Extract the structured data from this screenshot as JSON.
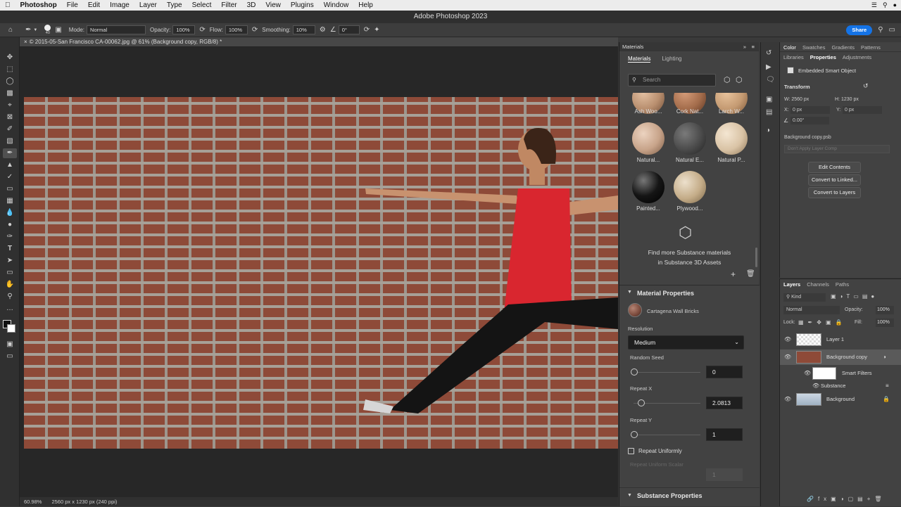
{
  "menubar": {
    "apple": "",
    "items": [
      "Photoshop",
      "File",
      "Edit",
      "Image",
      "Layer",
      "Type",
      "Select",
      "Filter",
      "3D",
      "View",
      "Plugins",
      "Window",
      "Help"
    ]
  },
  "title": "Adobe Photoshop 2023",
  "options": {
    "brush_size": "40",
    "mode_label": "Mode:",
    "mode_value": "Normal",
    "opacity_label": "Opacity:",
    "opacity_value": "100%",
    "flow_label": "Flow:",
    "flow_value": "100%",
    "smoothing_label": "Smoothing:",
    "smoothing_value": "10%",
    "angle_value": "0°",
    "share": "Share"
  },
  "doc_tab": "© 2015-05-San Francisco CA-00062.jpg @ 61% (Background copy, RGB/8) *",
  "status": {
    "zoom": "60.98%",
    "info": "2560 px x 1230 px (240 ppi)"
  },
  "materials": {
    "panel_title": "Materials",
    "tabs": [
      "Materials",
      "Lighting"
    ],
    "search_placeholder": "Search",
    "items": [
      {
        "label": "Ash Woo...",
        "color": "#b88e6e"
      },
      {
        "label": "Cork Nat...",
        "color": "#a36c4b"
      },
      {
        "label": "Larch W...",
        "color": "#c49a72"
      },
      {
        "label": "Natural...",
        "color": "#c7a389"
      },
      {
        "label": "Natural E...",
        "color": "#4a4a4a"
      },
      {
        "label": "Natural P...",
        "color": "#d9c3a5"
      },
      {
        "label": "Painted...",
        "color": "#151515"
      },
      {
        "label": "Plywood...",
        "color": "#c4ac88"
      }
    ],
    "find_more_line1": "Find more Substance materials",
    "find_more_line2": "in Substance 3D Assets"
  },
  "material_properties": {
    "title": "Material Properties",
    "material_name": "Cartagena Wall Bricks",
    "resolution_label": "Resolution",
    "resolution_value": "Medium",
    "random_seed_label": "Random Seed",
    "random_seed_value": "0",
    "repeat_x_label": "Repeat X",
    "repeat_x_value": "2.0813",
    "repeat_y_label": "Repeat Y",
    "repeat_y_value": "1",
    "repeat_uniformly": "Repeat Uniformly",
    "repeat_uniform_scalar": "Repeat Uniform Scalar",
    "repeat_uniform_scalar_value": "1",
    "substance_properties": "Substance Properties"
  },
  "properties": {
    "top_tabs": [
      "Color",
      "Swatches",
      "Gradients",
      "Patterns"
    ],
    "tabs": [
      "Libraries",
      "Properties",
      "Adjustments"
    ],
    "type": "Embedded Smart Object",
    "transform": "Transform",
    "w": "W: 2560 px",
    "h": "H: 1230 px",
    "x": "0 px",
    "y": "0 px",
    "x_label": "X:",
    "y_label": "Y:",
    "angle": "0.00°",
    "file": "Background copy.psb",
    "comp": "Don't Apply Layer Comp",
    "btn_edit": "Edit Contents",
    "btn_convert_linked": "Convert to Linked...",
    "btn_convert_layers": "Convert to Layers"
  },
  "layers": {
    "tabs": [
      "Layers",
      "Channels",
      "Paths"
    ],
    "kind": "Kind",
    "blend": "Normal",
    "opacity_label": "Opacity:",
    "opacity": "100%",
    "lock_label": "Lock:",
    "fill_label": "Fill:",
    "fill": "100%",
    "rows": [
      "Layer 1",
      "Background copy",
      "Smart Filters",
      "Substance",
      "Background"
    ]
  }
}
